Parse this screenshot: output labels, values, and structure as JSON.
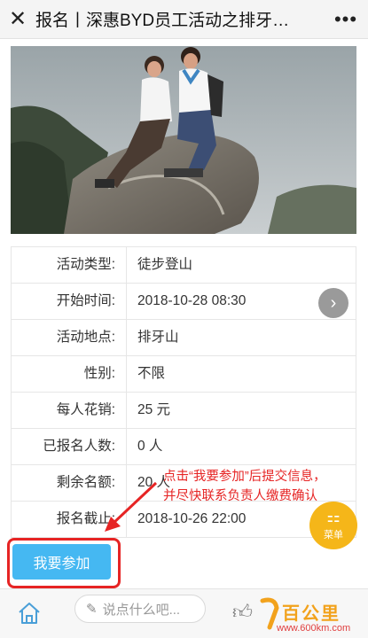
{
  "header": {
    "close_icon": "close-icon",
    "title": "报名丨深惠BYD员工活动之排牙…",
    "more_icon": "more-icon"
  },
  "activity": {
    "rows": [
      {
        "label": "活动类型:",
        "value": "徒步登山"
      },
      {
        "label": "开始时间:",
        "value": "2018-10-28 08:30"
      },
      {
        "label": "活动地点:",
        "value": "排牙山"
      },
      {
        "label": "性别:",
        "value": "不限"
      },
      {
        "label": "每人花销:",
        "value": "25 元"
      },
      {
        "label": "已报名人数:",
        "value": "0 人"
      },
      {
        "label": "剩余名额:",
        "value": "20 人"
      },
      {
        "label": "报名截止:",
        "value": "2018-10-26 22:00"
      }
    ]
  },
  "floating": {
    "arrow_icon": "chevron-right-icon",
    "menu_label": "菜单",
    "menu_icon": "grid-icon"
  },
  "join": {
    "button_label": "我要参加"
  },
  "annotation": {
    "line1": "点击“我要参加”后提交信息，",
    "line2": "并尽快联系负责人缴费确认"
  },
  "bottom_bar": {
    "comment_placeholder": "说点什么吧...",
    "home_icon": "home-icon",
    "like_icon": "thumbs-up-icon"
  },
  "watermark": {
    "text": "百公里",
    "url": "www.600km.com"
  },
  "colors": {
    "accent_blue": "#45b8f2",
    "annotation_red": "#e62424",
    "menu_orange": "#f5b619"
  }
}
